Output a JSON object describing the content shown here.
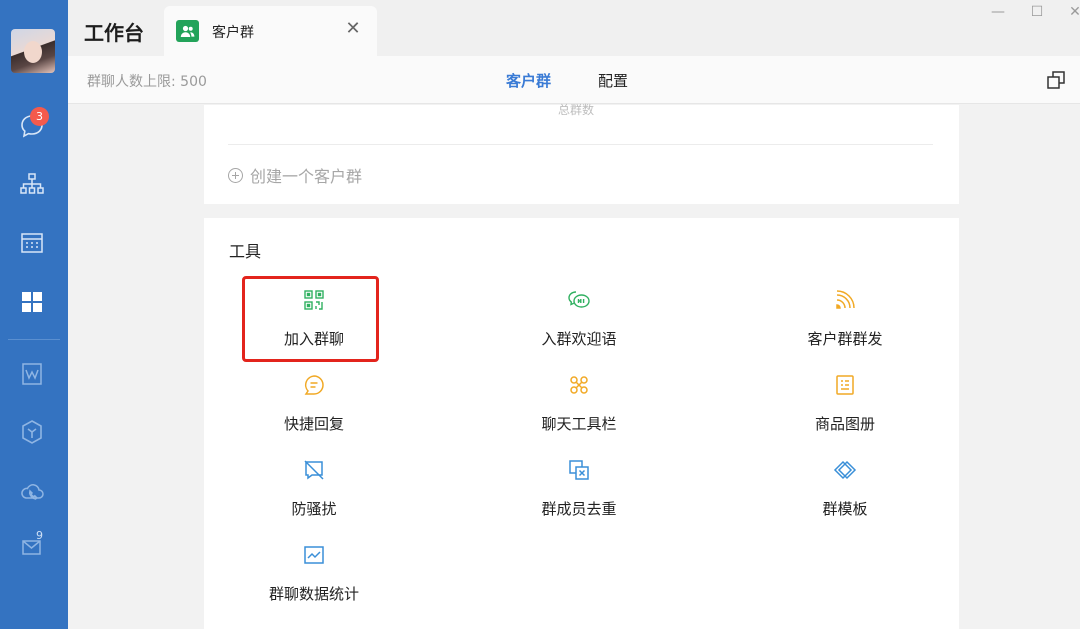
{
  "sidebar": {
    "chat_badge": "3",
    "mail_count": "9"
  },
  "titlebar": {
    "app_title": "工作台",
    "tab_label": "客户群",
    "tab_close": "✕",
    "minimize": "—",
    "maximize": "☐",
    "close": "✕"
  },
  "subheader": {
    "limit_text": "群聊人数上限: 500",
    "tabs": [
      "客户群",
      "配置"
    ]
  },
  "group_card": {
    "cut_label": "总群数",
    "create_label": "创建一个客户群"
  },
  "tools": {
    "title": "工具",
    "items": [
      {
        "label": "加入群聊",
        "icon": "qr-code-icon",
        "color": "#30b060"
      },
      {
        "label": "入群欢迎语",
        "icon": "chat-hi-icon",
        "color": "#30b060"
      },
      {
        "label": "客户群群发",
        "icon": "broadcast-icon",
        "color": "#f1a925"
      },
      {
        "label": "快捷回复",
        "icon": "quick-reply-icon",
        "color": "#f1a925"
      },
      {
        "label": "聊天工具栏",
        "icon": "toolbar-icon",
        "color": "#f1a925"
      },
      {
        "label": "商品图册",
        "icon": "catalog-icon",
        "color": "#f1a925"
      },
      {
        "label": "防骚扰",
        "icon": "anti-harass-icon",
        "color": "#3a8fd8"
      },
      {
        "label": "群成员去重",
        "icon": "dedupe-icon",
        "color": "#3a8fd8"
      },
      {
        "label": "群模板",
        "icon": "template-icon",
        "color": "#3a8fd8"
      },
      {
        "label": "群聊数据统计",
        "icon": "statistics-icon",
        "color": "#3a8fd8"
      }
    ]
  },
  "colors": {
    "sidebar": "#3473c1",
    "accent": "#3a7bd5",
    "highlight": "#e3241c"
  }
}
